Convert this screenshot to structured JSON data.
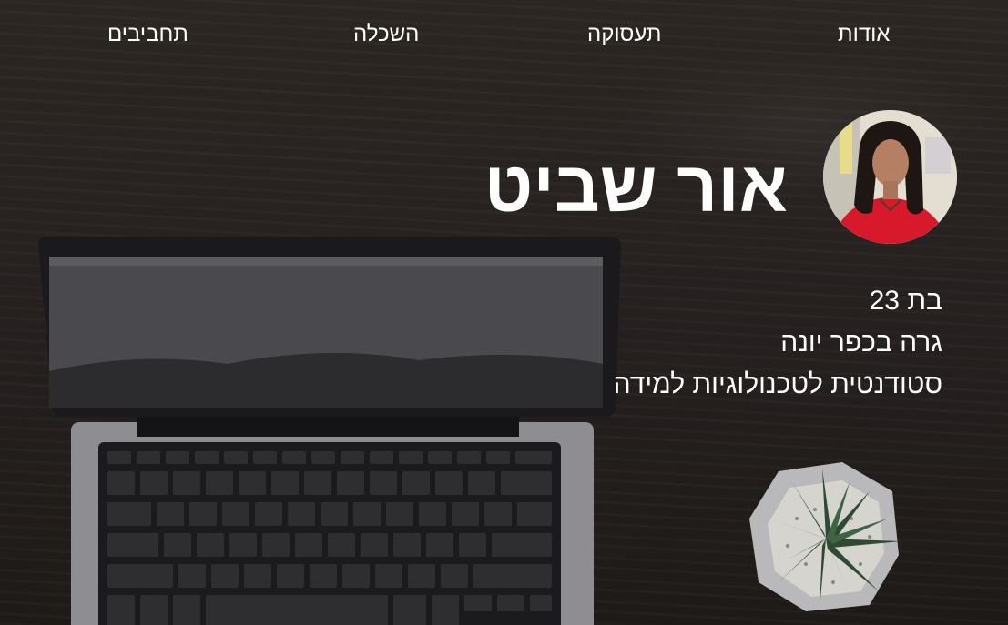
{
  "nav": {
    "items": [
      {
        "label": "אודות"
      },
      {
        "label": "תעסוקה"
      },
      {
        "label": "השכלה"
      },
      {
        "label": "תחביבים"
      }
    ]
  },
  "profile": {
    "name": "אור שביט",
    "facts": [
      "בת 23",
      "גרה בכפר יונה",
      "סטודנטית לטכנולוגיות למידה"
    ]
  }
}
